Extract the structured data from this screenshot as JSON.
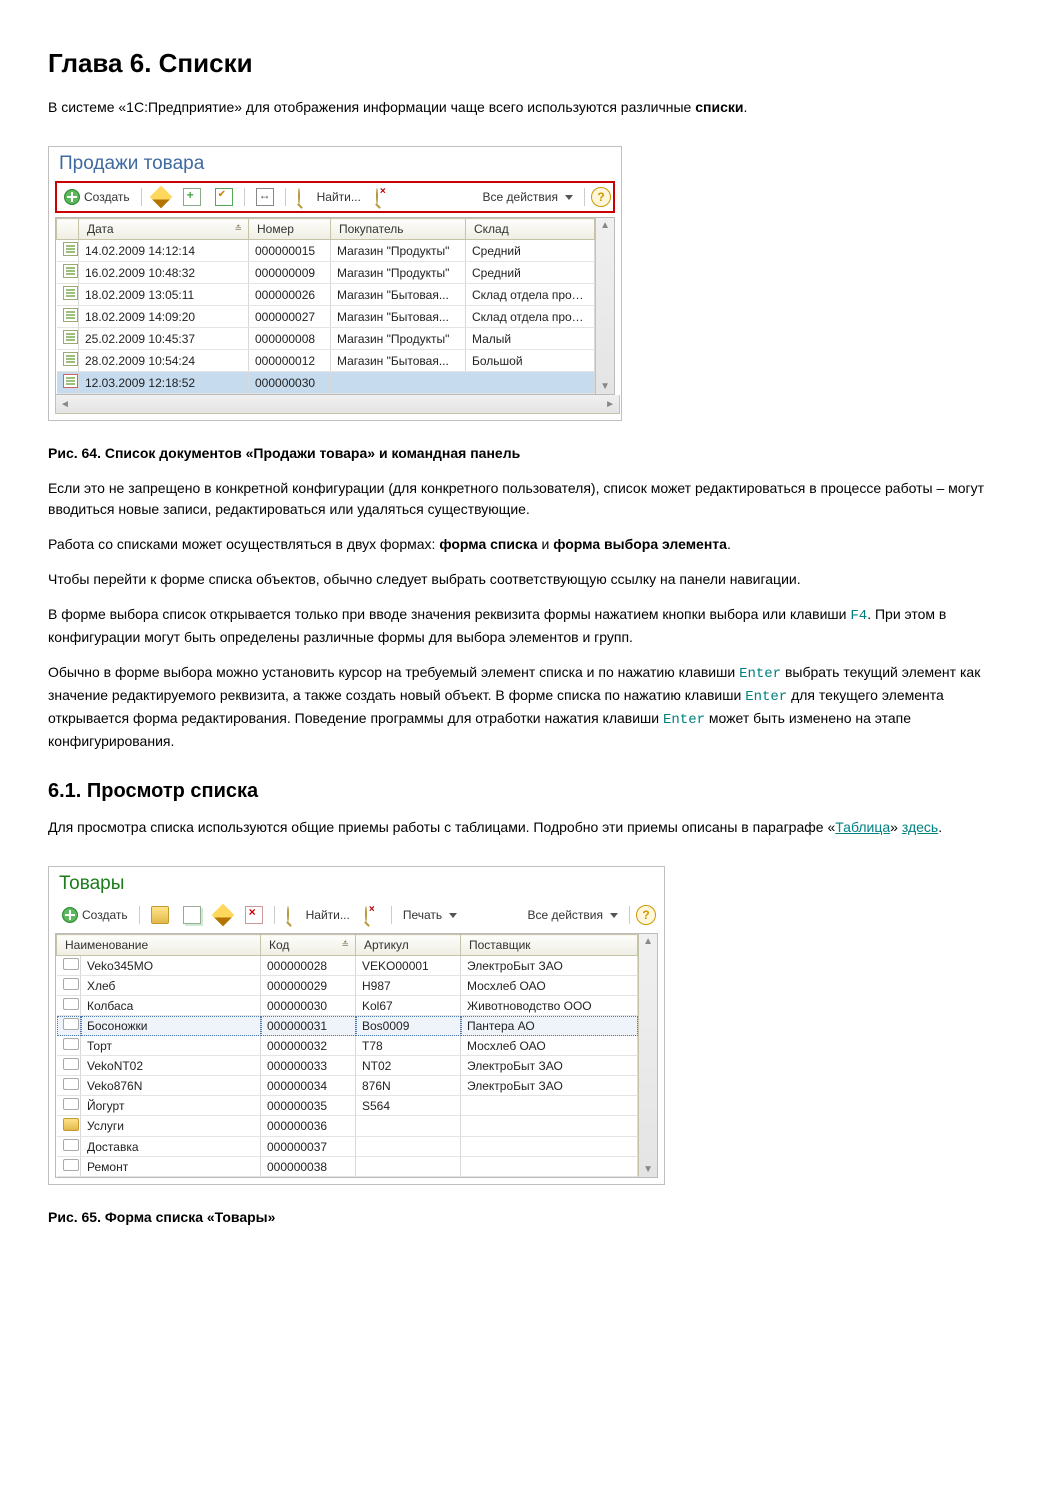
{
  "heading": "Глава 6. Списки",
  "intro": {
    "part1": "В системе «1С:Предприятие» для отображения информации чаще всего используются различные ",
    "bold": "списки",
    "part2": "."
  },
  "fig64": {
    "title": "Продажи товара",
    "toolbar": {
      "create": "Создать",
      "find": "Найти...",
      "allActions": "Все действия"
    },
    "columns": [
      "Дата",
      "Номер",
      "Покупатель",
      "Склад"
    ],
    "rows": [
      {
        "date": "14.02.2009 14:12:14",
        "num": "000000015",
        "buyer": "Магазин \"Продукты\"",
        "store": "Средний",
        "marked": false
      },
      {
        "date": "16.02.2009 10:48:32",
        "num": "000000009",
        "buyer": "Магазин \"Продукты\"",
        "store": "Средний",
        "marked": false
      },
      {
        "date": "18.02.2009 13:05:11",
        "num": "000000026",
        "buyer": "Магазин \"Бытовая...",
        "store": "Склад отдела прод...",
        "marked": false
      },
      {
        "date": "18.02.2009 14:09:20",
        "num": "000000027",
        "buyer": "Магазин \"Бытовая...",
        "store": "Склад отдела прод...",
        "marked": false
      },
      {
        "date": "25.02.2009 10:45:37",
        "num": "000000008",
        "buyer": "Магазин \"Продукты\"",
        "store": "Малый",
        "marked": false
      },
      {
        "date": "28.02.2009 10:54:24",
        "num": "000000012",
        "buyer": "Магазин \"Бытовая...",
        "store": "Большой",
        "marked": false
      },
      {
        "date": "12.03.2009 12:18:52",
        "num": "000000030",
        "buyer": "",
        "store": "",
        "marked": true,
        "selected": true
      }
    ],
    "caption": "Рис. 64. Список документов «Продажи товара» и командная панель"
  },
  "para2": "Если это не запрещено в конкретной конфигурации (для конкретного пользователя), список может редактироваться в процессе работы – могут вводиться новые записи, редактироваться или удаляться существующие.",
  "para3": {
    "p1": "Работа со списками может осуществляться в двух формах: ",
    "b1": "форма списка",
    "p2": " и ",
    "b2": "форма выбора элемента",
    "p3": "."
  },
  "para4": "Чтобы перейти к форме списка объектов, обычно следует выбрать соответствующую ссылку на панели навигации.",
  "para5": {
    "p1": "В форме выбора список открывается только при вводе значения реквизита формы нажатием кнопки выбора или клавиши ",
    "k1": "F4",
    "p2": ". При этом в конфигурации могут быть определены различные формы для выбора элементов и групп."
  },
  "para6": {
    "p1": "Обычно в форме выбора можно установить курсор на требуемый элемент списка и по нажатию клавиши ",
    "k1": "Enter",
    "p2": " выбрать текущий элемент как значение редактируемого реквизита, а также создать новый объект. В форме списка по нажатию клавиши ",
    "k2": "Enter",
    "p3": " для текущего элемента открывается форма редактирования. Поведение программы для отработки нажатия клавиши ",
    "k3": "Enter",
    "p4": " может быть изменено на этапе конфигурирования."
  },
  "section61": "6.1. Просмотр списка",
  "para7": {
    "p1": "Для просмотра списка используются общие приемы работы с таблицами. Подробно эти приемы описаны в параграфе «",
    "link1": "Таблица",
    "p2": "» ",
    "link2": "здесь",
    "p3": "."
  },
  "fig65": {
    "title": "Товары",
    "toolbar": {
      "create": "Создать",
      "find": "Найти...",
      "print": "Печать",
      "allActions": "Все действия"
    },
    "columns": [
      "Наименование",
      "Код",
      "Артикул",
      "Поставщик"
    ],
    "rows": [
      {
        "name": "Veko345MO",
        "code": "000000028",
        "art": "VEKO00001",
        "supp": "ЭлектроБыт ЗАО",
        "type": "item"
      },
      {
        "name": "Хлеб",
        "code": "000000029",
        "art": "H987",
        "supp": "Мосхлеб ОАО",
        "type": "item"
      },
      {
        "name": "Колбаса",
        "code": "000000030",
        "art": "Kol67",
        "supp": "Животноводство ООО",
        "type": "item"
      },
      {
        "name": "Босоножки",
        "code": "000000031",
        "art": "Bos0009",
        "supp": "Пантера АО",
        "type": "item",
        "selected": true
      },
      {
        "name": "Торт",
        "code": "000000032",
        "art": "T78",
        "supp": "Мосхлеб ОАО",
        "type": "item"
      },
      {
        "name": "VekoNT02",
        "code": "000000033",
        "art": "NT02",
        "supp": "ЭлектроБыт ЗАО",
        "type": "item"
      },
      {
        "name": "Veko876N",
        "code": "000000034",
        "art": "876N",
        "supp": "ЭлектроБыт ЗАО",
        "type": "item"
      },
      {
        "name": "Йогурт",
        "code": "000000035",
        "art": "S564",
        "supp": "",
        "type": "item"
      },
      {
        "name": "Услуги",
        "code": "000000036",
        "art": "",
        "supp": "",
        "type": "folder"
      },
      {
        "name": "Доставка",
        "code": "000000037",
        "art": "",
        "supp": "",
        "type": "item"
      },
      {
        "name": "Ремонт",
        "code": "000000038",
        "art": "",
        "supp": "",
        "type": "item"
      }
    ],
    "caption": "Рис. 65. Форма списка «Товары»"
  }
}
